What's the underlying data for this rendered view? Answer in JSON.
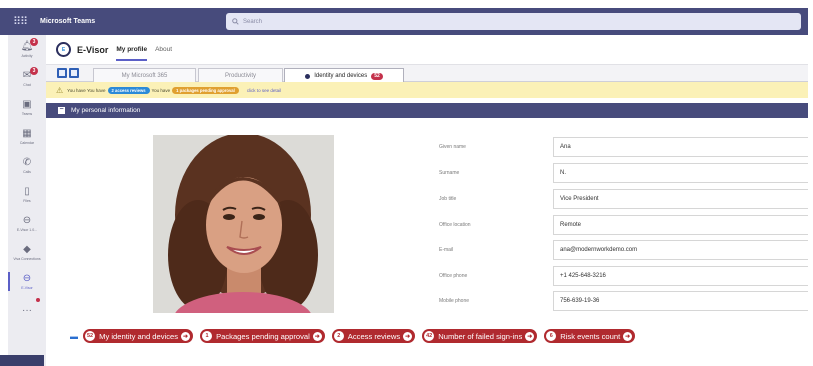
{
  "topbar": {
    "app_name": "Microsoft Teams",
    "search_placeholder": "Search"
  },
  "rail": [
    {
      "label": "Activity",
      "icon": "bell-icon",
      "badge": "3"
    },
    {
      "label": "Chat",
      "icon": "chat-icon",
      "badge": "3"
    },
    {
      "label": "Teams",
      "icon": "teams-icon"
    },
    {
      "label": "Calendar",
      "icon": "calendar-icon"
    },
    {
      "label": "Calls",
      "icon": "phone-icon"
    },
    {
      "label": "Files",
      "icon": "file-icon"
    },
    {
      "label": "E-Visor 1.0...",
      "icon": "evisor-icon"
    },
    {
      "label": "Viva Connections",
      "icon": "viva-icon"
    },
    {
      "label": "E-Visor",
      "icon": "evisor-icon"
    }
  ],
  "app": {
    "title": "E-Visor",
    "tabs": [
      "My profile",
      "About"
    ],
    "active_tab": "My profile"
  },
  "page_tabs": [
    "My Microsoft 365",
    "Productivity",
    "Identity and devices"
  ],
  "identity_badge": "52",
  "notice": {
    "prefix": "You have You have",
    "pill1": "2 access reviews",
    "middle": "You have",
    "pill2": "1 packages pending approval",
    "link": "click to see detail"
  },
  "section": {
    "title": "My personal information",
    "toggle": "−"
  },
  "form": [
    {
      "label": "Given name",
      "value": "Ana"
    },
    {
      "label": "Surname",
      "value": "N."
    },
    {
      "label": "Job title",
      "value": "Vice President"
    },
    {
      "label": "Office location",
      "value": "Remote"
    },
    {
      "label": "E-mail",
      "value": "ana@modernworkdemo.com"
    },
    {
      "label": "Office phone",
      "value": "+1 425-648-3216"
    },
    {
      "label": "Mobile phone",
      "value": "756-639-19-36"
    }
  ],
  "summary": [
    {
      "count": "52",
      "label": "My identity and devices"
    },
    {
      "count": "1",
      "label": "Packages pending approval"
    },
    {
      "count": "2",
      "label": "Access reviews"
    },
    {
      "count": "42",
      "label": "Number of failed sign-ins"
    },
    {
      "count": "6",
      "label": "Risk events count"
    }
  ],
  "colors": {
    "teams_purple": "#474b7c",
    "accent": "#5b5fc7",
    "badge_red": "#b02a2f",
    "notice_yellow": "#fbf1b7"
  }
}
